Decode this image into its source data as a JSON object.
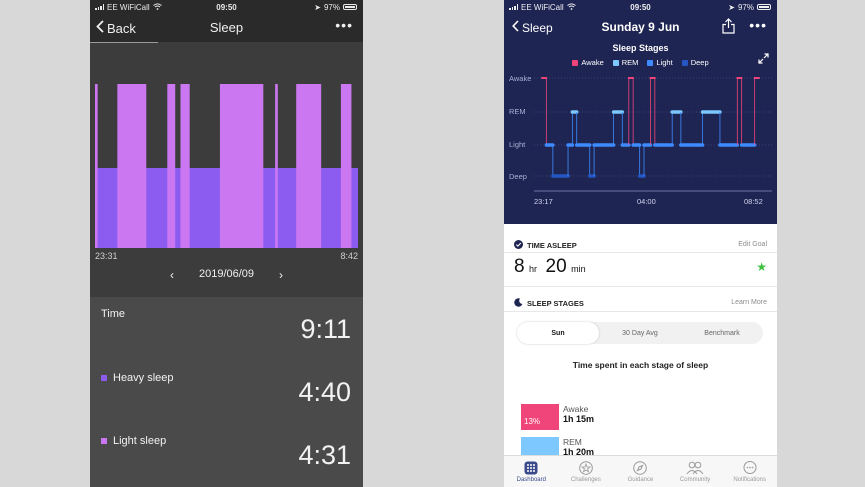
{
  "left_app": {
    "status": {
      "carrier": "EE WiFiCall",
      "time": "09:50",
      "battery": "97%"
    },
    "nav": {
      "back_label": "Back",
      "title": "Sleep",
      "more": "•••"
    },
    "chart_data": {
      "type": "bar",
      "title": "",
      "x_start_label": "23:31",
      "x_end_label": "8:42",
      "series": [
        {
          "name": "Heavy sleep",
          "color": "#8c5cf0"
        },
        {
          "name": "Light sleep",
          "color": "#cc77f2"
        }
      ],
      "segments": [
        {
          "start": 0.0,
          "end": 0.01,
          "level": "light"
        },
        {
          "start": 0.01,
          "end": 0.085,
          "level": "heavy"
        },
        {
          "start": 0.085,
          "end": 0.195,
          "level": "light"
        },
        {
          "start": 0.195,
          "end": 0.275,
          "level": "heavy"
        },
        {
          "start": 0.275,
          "end": 0.305,
          "level": "light"
        },
        {
          "start": 0.305,
          "end": 0.325,
          "level": "heavy"
        },
        {
          "start": 0.325,
          "end": 0.36,
          "level": "light"
        },
        {
          "start": 0.36,
          "end": 0.475,
          "level": "heavy"
        },
        {
          "start": 0.475,
          "end": 0.64,
          "level": "light"
        },
        {
          "start": 0.64,
          "end": 0.685,
          "level": "heavy"
        },
        {
          "start": 0.685,
          "end": 0.695,
          "level": "light"
        },
        {
          "start": 0.695,
          "end": 0.765,
          "level": "heavy"
        },
        {
          "start": 0.765,
          "end": 0.86,
          "level": "light"
        },
        {
          "start": 0.86,
          "end": 0.935,
          "level": "heavy"
        },
        {
          "start": 0.935,
          "end": 0.975,
          "level": "light"
        },
        {
          "start": 0.975,
          "end": 1.0,
          "level": "heavy"
        }
      ]
    },
    "date": {
      "value": "2019/06/09",
      "prev": "‹",
      "next": "›"
    },
    "stats": {
      "time_label": "Time",
      "time_value": "9:11",
      "heavy_label": "Heavy sleep",
      "heavy_value": "4:40",
      "light_label": "Light sleep",
      "light_value": "4:31"
    }
  },
  "right_app": {
    "status": {
      "carrier": "EE WiFiCall",
      "time": "09:50",
      "battery": "97%"
    },
    "nav": {
      "back_label": "Sleep",
      "title": "Sunday 9 Jun",
      "more": "•••"
    },
    "chart_data": {
      "type": "line",
      "title": "Sleep Stages",
      "levels": [
        "Awake",
        "REM",
        "Light",
        "Deep"
      ],
      "legend": [
        {
          "name": "Awake",
          "color": "#f0457a"
        },
        {
          "name": "REM",
          "color": "#7cc8ff"
        },
        {
          "name": "Light",
          "color": "#3d8bff"
        },
        {
          "name": "Deep",
          "color": "#2456c4"
        }
      ],
      "x_labels": [
        "23:17",
        "04:00",
        "08:52"
      ],
      "steps": [
        {
          "t": 0.0,
          "stage": "Awake"
        },
        {
          "t": 0.02,
          "stage": "Light"
        },
        {
          "t": 0.05,
          "stage": "Deep"
        },
        {
          "t": 0.12,
          "stage": "Light"
        },
        {
          "t": 0.14,
          "stage": "REM"
        },
        {
          "t": 0.16,
          "stage": "Light"
        },
        {
          "t": 0.22,
          "stage": "Deep"
        },
        {
          "t": 0.24,
          "stage": "Light"
        },
        {
          "t": 0.33,
          "stage": "REM"
        },
        {
          "t": 0.37,
          "stage": "Light"
        },
        {
          "t": 0.4,
          "stage": "Awake"
        },
        {
          "t": 0.42,
          "stage": "Light"
        },
        {
          "t": 0.45,
          "stage": "Deep"
        },
        {
          "t": 0.47,
          "stage": "Light"
        },
        {
          "t": 0.5,
          "stage": "Awake"
        },
        {
          "t": 0.52,
          "stage": "Light"
        },
        {
          "t": 0.6,
          "stage": "REM"
        },
        {
          "t": 0.64,
          "stage": "Light"
        },
        {
          "t": 0.74,
          "stage": "REM"
        },
        {
          "t": 0.82,
          "stage": "Light"
        },
        {
          "t": 0.9,
          "stage": "Awake"
        },
        {
          "t": 0.92,
          "stage": "Light"
        },
        {
          "t": 0.98,
          "stage": "Awake"
        },
        {
          "t": 1.0,
          "stage": "Awake"
        }
      ]
    },
    "time_asleep": {
      "header": "TIME ASLEEP",
      "link": "Edit Goal",
      "hours": "8",
      "hours_unit": "hr",
      "minutes": "20",
      "minutes_unit": "min"
    },
    "sleep_stages": {
      "header": "SLEEP STAGES",
      "link": "Learn More",
      "tabs": [
        "Sun",
        "30 Day Avg",
        "Benchmark"
      ],
      "subtitle": "Time spent in each stage of sleep",
      "rows": [
        {
          "pct": "13%",
          "name": "Awake",
          "duration": "1h 15m",
          "color": "#f0457a"
        },
        {
          "pct": "",
          "name": "REM",
          "duration": "1h 20m",
          "color": "#7cc8ff"
        }
      ]
    },
    "tab_bar": [
      "Dashboard",
      "Challenges",
      "Guidance",
      "Community",
      "Notifications"
    ]
  }
}
